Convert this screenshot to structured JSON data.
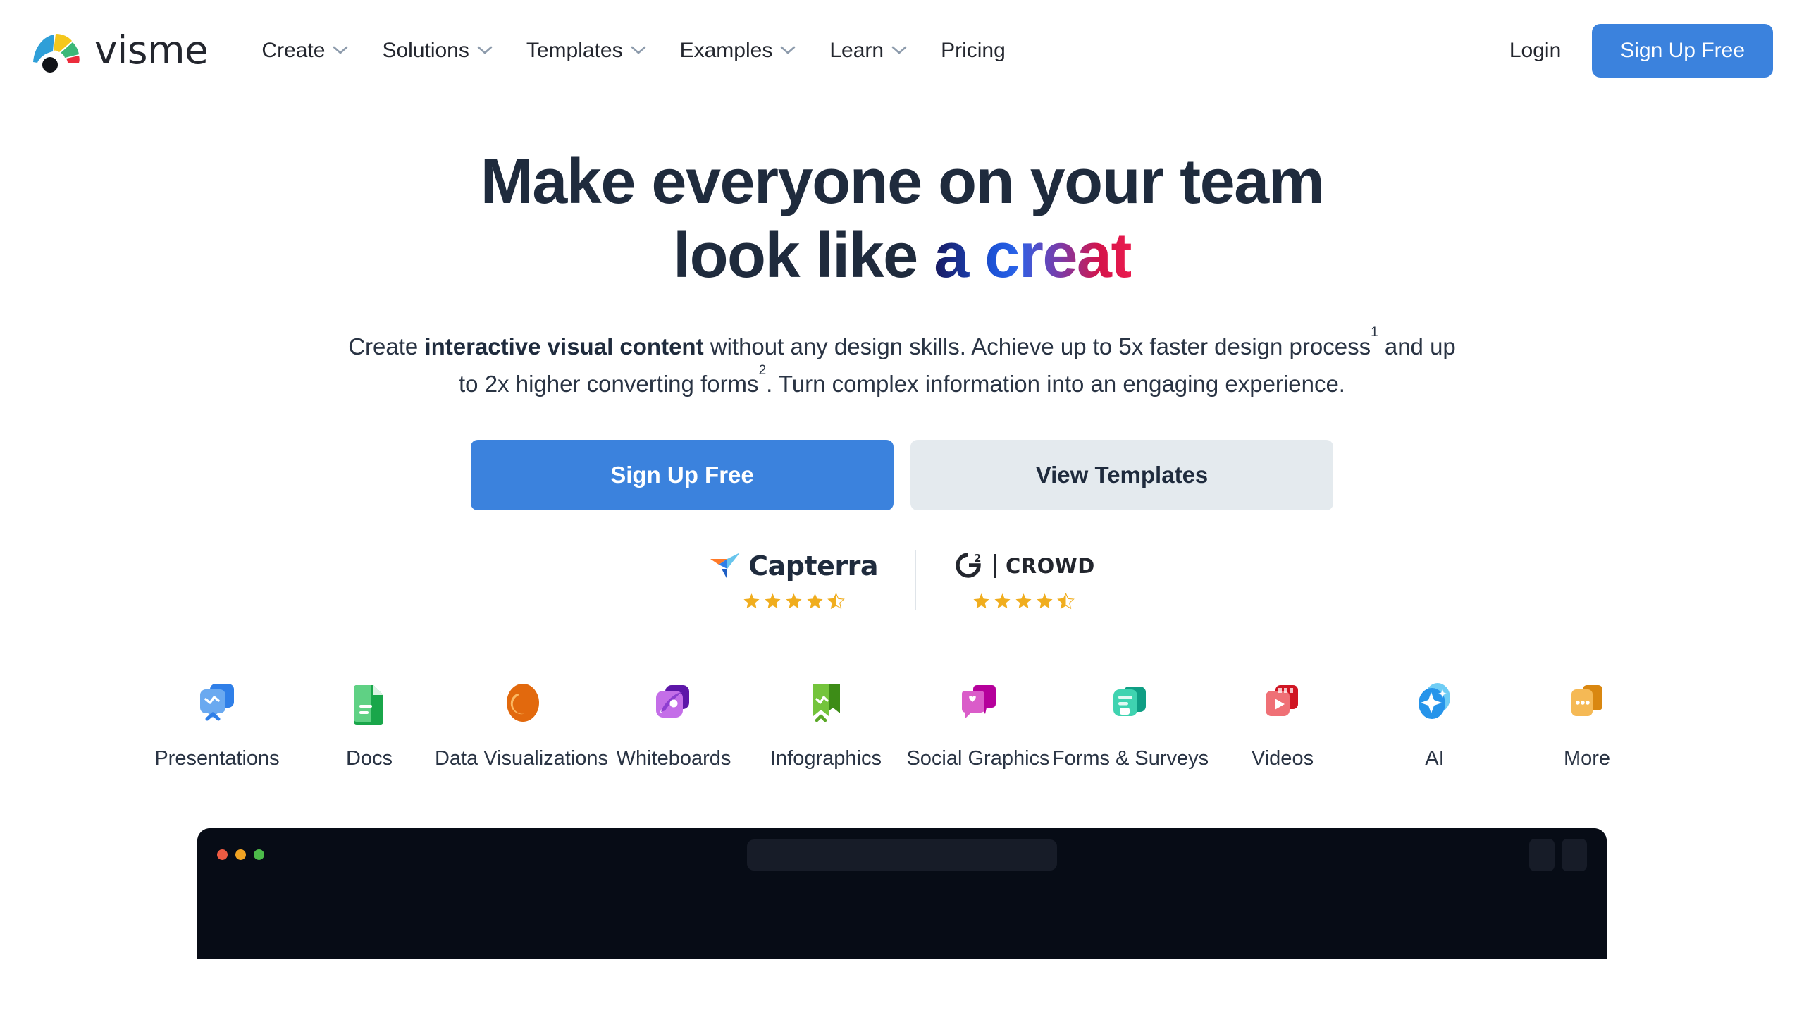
{
  "brand": {
    "name": "visme",
    "logo_icon": "visme-chameleon-logo",
    "logo_colors": [
      "#2f9fd8",
      "#f4c71c",
      "#3cb878",
      "#ec2c3c",
      "#111318"
    ]
  },
  "header": {
    "nav": [
      {
        "label": "Create",
        "has_dropdown": true
      },
      {
        "label": "Solutions",
        "has_dropdown": true
      },
      {
        "label": "Templates",
        "has_dropdown": true
      },
      {
        "label": "Examples",
        "has_dropdown": true
      },
      {
        "label": "Learn",
        "has_dropdown": true
      },
      {
        "label": "Pricing",
        "has_dropdown": false
      }
    ],
    "login_label": "Login",
    "signup_label": "Sign Up Free",
    "accent_color": "#3b82dd"
  },
  "hero": {
    "title_line1": "Make everyone on your team",
    "title_line2_plain": "look like ",
    "title_line2_gradient": "a creat",
    "gradient_colors": [
      "#18195e",
      "#1c52d6",
      "#7b3ba8",
      "#ea1b4e"
    ],
    "sub_part1": "Create ",
    "sub_bold1": "interactive visual content",
    "sub_part2": " without any design skills. Achieve up to 5x faster design process",
    "sub_sup1": "1",
    "sub_part3": " and up to 2x higher converting forms",
    "sub_sup2": "2",
    "sub_part4": ". Turn complex information into an engaging experience.",
    "cta_primary": "Sign Up Free",
    "cta_secondary": "View Templates"
  },
  "badges": [
    {
      "name": "Capterra",
      "logo_icon": "capterra-logo",
      "rating": 4.5,
      "stars_full": 4,
      "stars_half": 1,
      "star_color": "#f0ad1e"
    },
    {
      "name": "CROWD",
      "prefix": "G",
      "superscript": "2",
      "logo_icon": "g2-crowd-logo",
      "rating": 4.5,
      "stars_full": 4,
      "stars_half": 1,
      "star_color": "#f0ad1e"
    }
  ],
  "categories": [
    {
      "label": "Presentations",
      "icon": "presentation-icon",
      "color": "#2f7fe8",
      "color2": "#84b4f2"
    },
    {
      "label": "Docs",
      "icon": "document-icon",
      "color": "#19a64a",
      "color2": "#5fd184"
    },
    {
      "label": "Data Visualizations",
      "icon": "pie-chart-icon",
      "color": "#e2690d",
      "color2": "#f9a košt"
    },
    {
      "label": "Whiteboards",
      "icon": "rocket-whiteboard-icon",
      "color": "#5d16a8",
      "color2": "#c46ee8"
    },
    {
      "label": "Infographics",
      "icon": "banner-infographic-icon",
      "color": "#57ad27",
      "color2": "#a5dd6d"
    },
    {
      "label": "Social Graphics",
      "icon": "chat-heart-icon",
      "color": "#b5009b",
      "color2": "#e07ad6"
    },
    {
      "label": "Forms & Surveys",
      "icon": "form-stack-icon",
      "color": "#0f9e84",
      "color2": "#63e0c2"
    },
    {
      "label": "Videos",
      "icon": "video-play-icon",
      "color": "#d01624",
      "color2": "#f07a80"
    },
    {
      "label": "AI",
      "icon": "ai-sparkle-icon",
      "color": "#2694ea",
      "color2": "#7fd0f7"
    },
    {
      "label": "More",
      "icon": "more-cards-icon",
      "color": "#e09414",
      "color2": "#f6c768"
    }
  ],
  "browser_mock": {
    "traffic_lights": [
      "#ee5b43",
      "#f0a323",
      "#4cbb4a"
    ],
    "url_pill": "",
    "chrome_color": "#070c16"
  }
}
